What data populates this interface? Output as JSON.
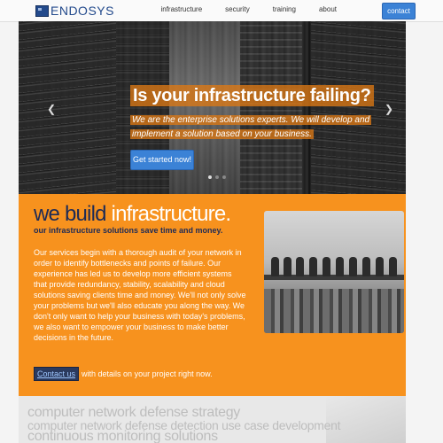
{
  "nav": {
    "logo_text": "ENDOSYS",
    "items": [
      {
        "label": "infrastructure"
      },
      {
        "label": "security"
      },
      {
        "label": "training"
      },
      {
        "label": "about"
      }
    ],
    "contact_label": "contact"
  },
  "hero": {
    "title": "Is your infrastructure failing?",
    "subtitle_line1": "We are the enterprise solutions experts. We will develop and",
    "subtitle_line2": "implement a solution based on your business.",
    "cta": "Get started now!",
    "prev_icon": "chevron-left-icon",
    "next_icon": "chevron-right-icon",
    "slide_count": 3,
    "active_slide": 1
  },
  "build": {
    "title_part1": "we build",
    "title_part2": "infrastructure.",
    "subtitle": "our infrastructure solutions save time and money.",
    "body": "Our services begin with a thorough audit of your network in order to identify bottlenecks and points of failure. Our experience has led us to develop more efficient systems that provide redundancy, stability, scalability and cloud solutions saving clients time and money. We'll not only solve your problems but we'll also educate you along the way. We don't only want to help your business with today's problems, we also want to empower your business to make better decisions in the future.",
    "contact_link": "Contact us",
    "contact_text": "with details on your project right now."
  },
  "services": {
    "line1": "computer network defense strategy",
    "line2": "computer network defense detection use case development",
    "line3": "continuous monitoring solutions"
  },
  "colors": {
    "accent_orange": "#f7921e",
    "button_blue": "#3b82d6",
    "navy": "#1e2b56"
  }
}
